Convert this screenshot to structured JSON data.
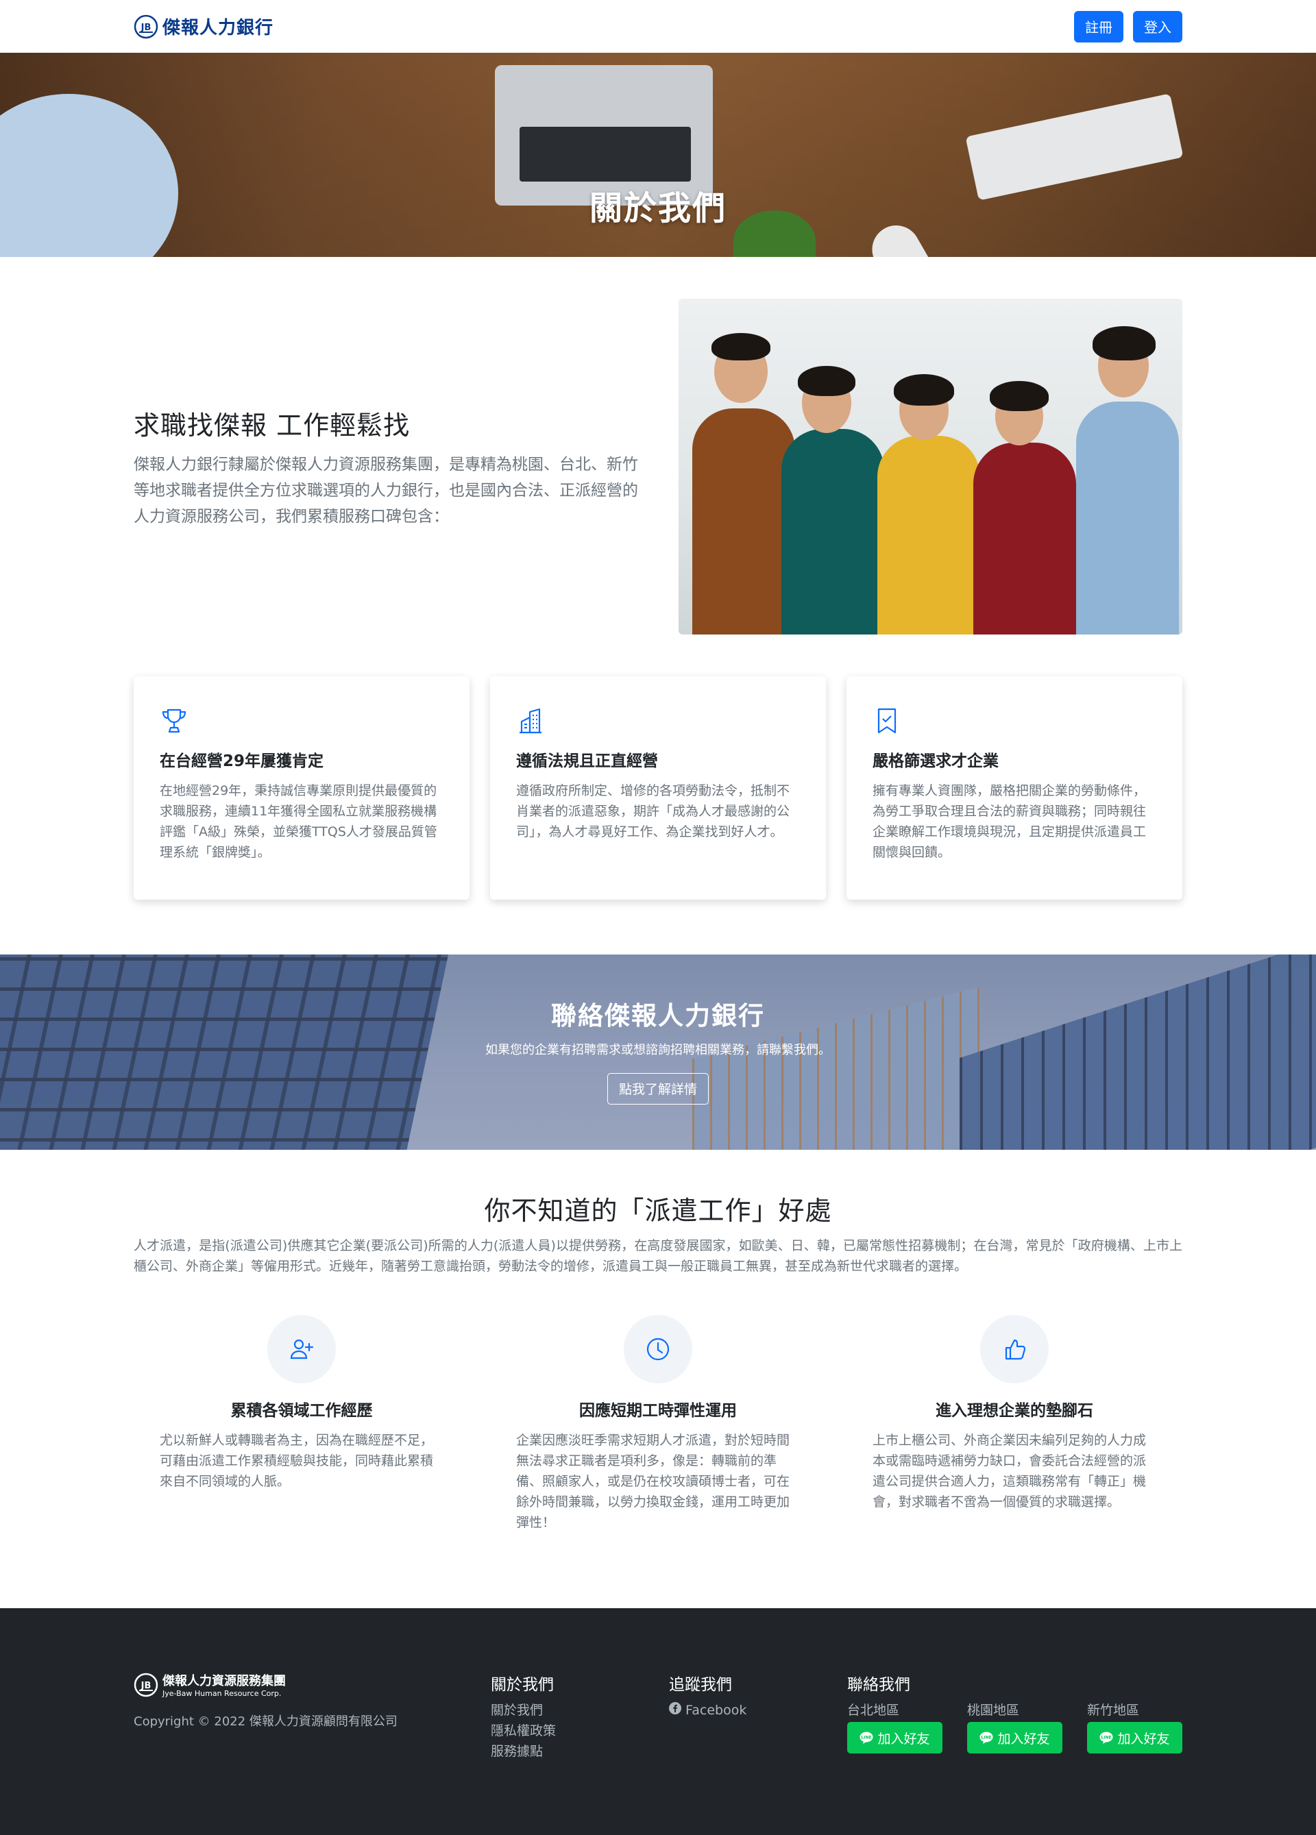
{
  "navbar": {
    "brand": "傑報人力銀行",
    "register_label": "註冊",
    "login_label": "登入"
  },
  "hero": {
    "title": "關於我們"
  },
  "intro": {
    "title": "求職找傑報 工作輕鬆找",
    "description": "傑報人力銀行隸屬於傑報人力資源服務集團，是專精為桃園、台北、新竹等地求職者提供全方位求職選項的人力銀行，也是國內合法、正派經營的人力資源服務公司，我們累積服務口碑包含："
  },
  "features": [
    {
      "icon": "trophy-icon",
      "title": "在台經營29年屢獲肯定",
      "description": "在地經營29年，秉持誠信專業原則提供最優質的求職服務，連續11年獲得全國私立就業服務機構評鑑「A級」殊榮，並榮獲TTQS人才發展品質管理系統「銀牌獎」。"
    },
    {
      "icon": "building-icon",
      "title": "遵循法規且正直經營",
      "description": "遵循政府所制定、增修的各項勞動法令，抵制不肖業者的派遣惡象，期許「成為人才最感謝的公司」，為人才尋覓好工作、為企業找到好人才。"
    },
    {
      "icon": "bookmark-check-icon",
      "title": "嚴格篩選求才企業",
      "description": "擁有專業人資團隊，嚴格把關企業的勞動條件，為勞工爭取合理且合法的薪資與職務；同時親往企業瞭解工作環境與現況，且定期提供派遣員工關懷與回饋。"
    }
  ],
  "contact_band": {
    "title": "聯絡傑報人力銀行",
    "description": "如果您的企業有招聘需求或想諮詢招聘相關業務，請聯繫我們。",
    "button_label": "點我了解詳情"
  },
  "dispatch": {
    "title": "你不知道的「派遣工作」好處",
    "description": "人才派遣，是指(派遣公司)供應其它企業(要派公司)所需的人力(派遣人員)以提供勞務，在高度發展國家，如歐美、日、韓，已屬常態性招募機制；在台灣，常見於「政府機構、上市上櫃公司、外商企業」等僱用形式。近幾年，隨著勞工意識抬頭，勞動法令的增修，派遣員工與一般正職員工無異，甚至成為新世代求職者的選擇。",
    "benefits": [
      {
        "icon": "person-plus-icon",
        "title": "累積各領域工作經歷",
        "description": "尤以新鮮人或轉職者為主，因為在職經歷不足，可藉由派遣工作累積經驗與技能，同時藉此累積來自不同領域的人脈。"
      },
      {
        "icon": "clock-icon",
        "title": "因應短期工時彈性運用",
        "description": "企業因應淡旺季需求短期人才派遣，對於短時間無法尋求正職者是項利多，像是：轉職前的準備、照顧家人，或是仍在校攻讀碩博士者，可在餘外時間兼職，以勞力換取金錢，運用工時更加彈性！"
      },
      {
        "icon": "thumbs-up-icon",
        "title": "進入理想企業的墊腳石",
        "description": "上市上櫃公司、外商企業因未編列足夠的人力成本或需臨時遞補勞力缺口，會委託合法經營的派遣公司提供合適人力，這類職務常有「轉正」機會，對求職者不啻為一個優質的求職選擇。"
      }
    ]
  },
  "footer": {
    "brand_cn": "傑報人力資源服務集團",
    "brand_en": "Jye-Baw Human Resource Corp.",
    "copyright": "Copyright © 2022 傑報人力資源顧問有限公司",
    "about": {
      "heading": "關於我們",
      "links": [
        "關於我們",
        "隱私權政策",
        "服務據點"
      ]
    },
    "follow": {
      "heading": "追蹤我們",
      "facebook": "Facebook"
    },
    "contact": {
      "heading": "聯絡我們",
      "regions": [
        {
          "name": "台北地區",
          "button": "加入好友"
        },
        {
          "name": "桃園地區",
          "button": "加入好友"
        },
        {
          "name": "新竹地區",
          "button": "加入好友"
        }
      ]
    }
  },
  "colors": {
    "primary": "#0d6efd",
    "brand_blue": "#0b3a8c",
    "line_green": "#06c755",
    "footer_bg": "#212529",
    "muted_text": "#6c757d"
  }
}
